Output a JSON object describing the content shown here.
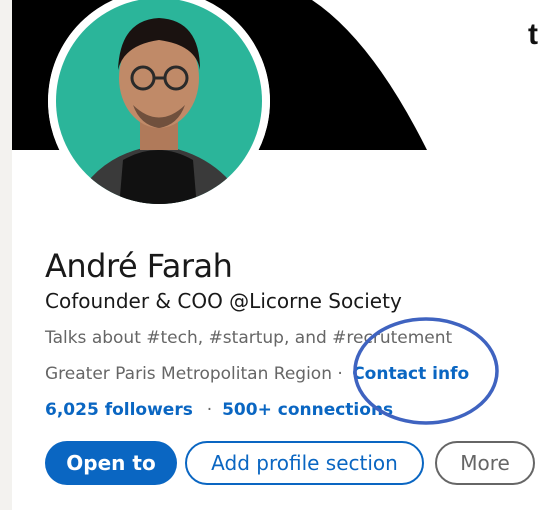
{
  "profile": {
    "name": "André Farah",
    "headline": "Cofounder & COO @Licorne Society",
    "talks_about": "Talks about #tech, #startup, and #recrutement",
    "location": "Greater Paris Metropolitan Region",
    "separator": "·",
    "contact_info_label": "Contact info",
    "followers": "6,025 followers",
    "connections": "500+ connections"
  },
  "actions": {
    "open_to_label": "Open to",
    "add_section_label": "Add profile section",
    "more_label": "More"
  },
  "edge_text": "t",
  "icons": {
    "avatar": "profile-photo",
    "annotation": "hand-drawn-ellipse"
  },
  "colors": {
    "accent": "#0a66c2",
    "avatar_bg": "#2bb59a",
    "annotation_ring": "#3f63c0",
    "banner": "#000000"
  }
}
